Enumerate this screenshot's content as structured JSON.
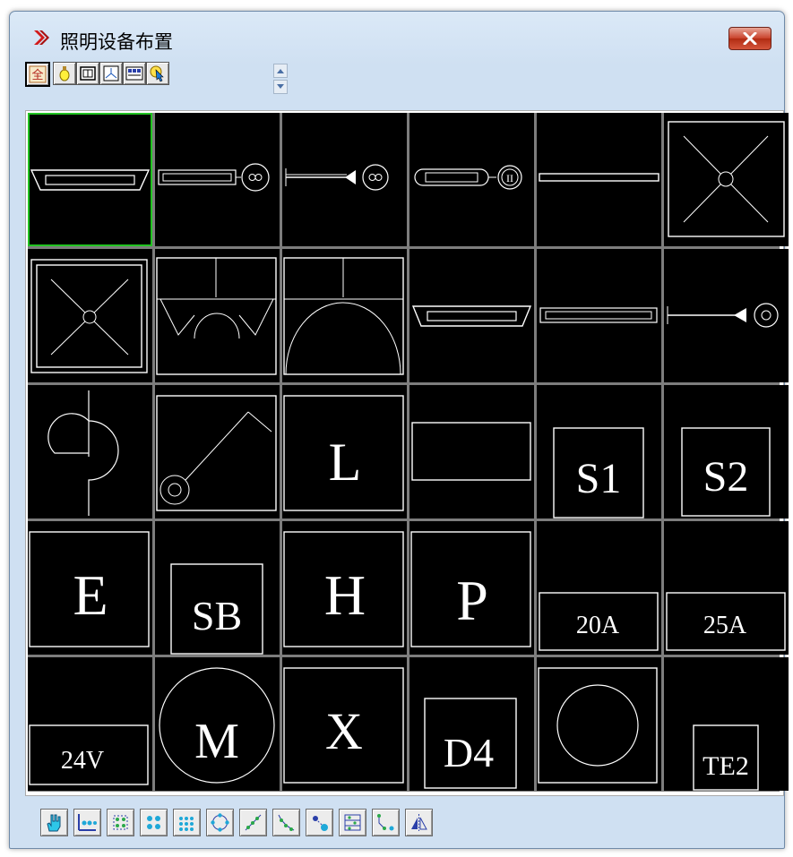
{
  "window": {
    "title": "照明设备布置"
  },
  "toolbar": {
    "buttons": [
      {
        "name": "all-icon",
        "label": "全"
      },
      {
        "name": "bulb-icon"
      },
      {
        "name": "panel-icon"
      },
      {
        "name": "junction-icon"
      },
      {
        "name": "switch-board-icon"
      },
      {
        "name": "pointer-icon"
      }
    ]
  },
  "symbols": {
    "s1": "S1",
    "s2": "S2",
    "l": "L",
    "e": "E",
    "sb": "SB",
    "h": "H",
    "p": "P",
    "a20": "20A",
    "a25": "25A",
    "v24": "24V",
    "m": "M",
    "x": "X",
    "d4": "D4",
    "te2": "TE2",
    "ii": "II"
  },
  "bottom_toolbar": {
    "buttons": [
      "hand-icon",
      "row-layout-icon",
      "matrix-layout-icon",
      "grid-layout-icon",
      "dots-layout-icon",
      "ring-layout-icon",
      "line-layout-icon",
      "curve-layout-icon",
      "spot-layout-icon",
      "list-layout-icon",
      "connect-layout-icon",
      "mirror-icon"
    ]
  },
  "colors": {
    "selected_border": "#22c322",
    "cell_bg": "#000000",
    "grid_line": "#7d7d7d"
  }
}
